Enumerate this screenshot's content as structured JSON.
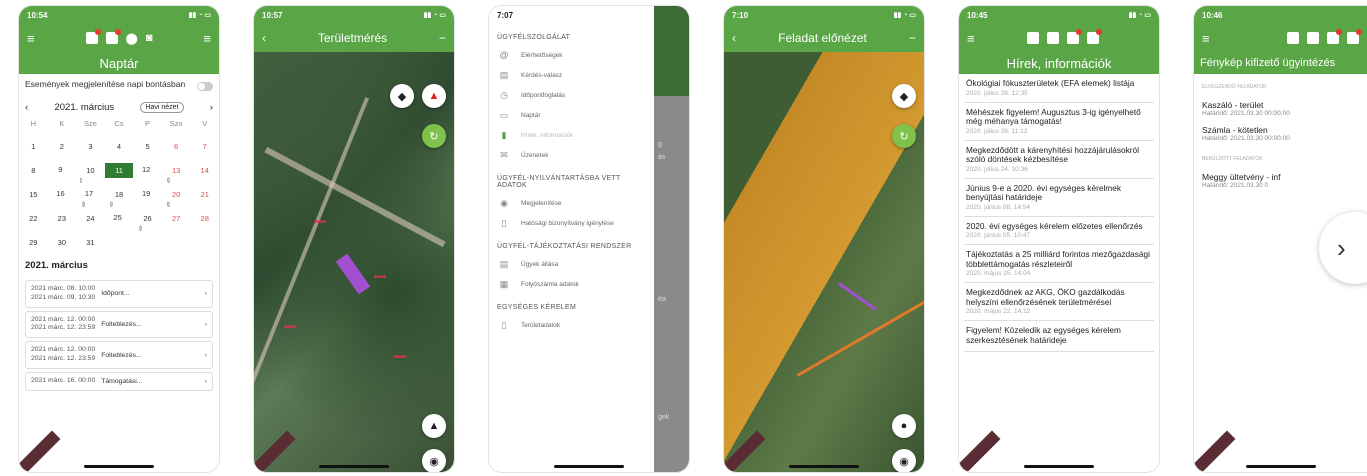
{
  "phone1": {
    "time": "10:54",
    "title": "Naptár",
    "toggle_label": "Események megjelenítése napi bontásban",
    "month": "2021. március",
    "today_button": "Havi nézet",
    "weekdays": [
      "H",
      "K",
      "Sze",
      "Cs",
      "P",
      "Szo",
      "V"
    ],
    "weeks": [
      [
        "1",
        "2",
        "3",
        "4",
        "5",
        "6",
        "7"
      ],
      [
        "8",
        "9",
        "10",
        "11",
        "12",
        "13",
        "14"
      ],
      [
        "15",
        "16",
        "17",
        "18",
        "19",
        "20",
        "21"
      ],
      [
        "22",
        "23",
        "24",
        "25",
        "26",
        "27",
        "28"
      ],
      [
        "29",
        "30",
        "31",
        "",
        "",
        "",
        ""
      ]
    ],
    "selected_day": "11",
    "section_title": "2021. március",
    "events": [
      {
        "time": "2021 márc. 08. 10:00\n2021 márc. 09. 10:30",
        "desc": "Időpont..."
      },
      {
        "time": "2021 márc. 12. 00:00\n2021 márc. 12. 23:59",
        "desc": "Folteblezés..."
      },
      {
        "time": "2021 márc. 12. 00:00\n2021 márc. 12. 23:59",
        "desc": "Folteblezés..."
      },
      {
        "time": "2021 márc. 16. 00:00",
        "desc": "Támogatási..."
      }
    ]
  },
  "phone2": {
    "time": "10:57",
    "title": "Területmérés"
  },
  "phone3": {
    "time": "7:07",
    "sections": [
      {
        "title": "ÜGYFÉLSZOLGÁLAT",
        "items": [
          {
            "icon": "@",
            "label": "Elérhetőségek"
          },
          {
            "icon": "▤",
            "label": "Kérdés-válasz"
          },
          {
            "icon": "◷",
            "label": "Időpontfoglalás"
          },
          {
            "icon": "▭",
            "label": "Naptár"
          },
          {
            "icon": "▮",
            "label": "Hírek, információk",
            "active": true
          },
          {
            "icon": "✉",
            "label": "Üzenetek"
          }
        ]
      },
      {
        "title": "ÜGYFÉL-NYILVÁNTARTÁSBA VETT ADATOK",
        "items": [
          {
            "icon": "◉",
            "label": "Megjelenítése"
          },
          {
            "icon": "▯",
            "label": "Hatósági bizonyítvány igénylése"
          }
        ]
      },
      {
        "title": "ÜGYFÉL-TÁJÉKOZTATÁSI RENDSZER",
        "items": [
          {
            "icon": "▤",
            "label": "Ügyek állása"
          },
          {
            "icon": "▦",
            "label": "Folyószámla adatok"
          }
        ]
      },
      {
        "title": "EGYSÉGES KÉRELEM",
        "items": [
          {
            "icon": "▯",
            "label": "Területadatok"
          }
        ]
      }
    ],
    "bg_texts": [
      "g",
      "ás",
      "éa",
      "gek"
    ]
  },
  "phone4": {
    "time": "7:10",
    "title": "Feladat előnézet"
  },
  "phone5": {
    "time": "10:45",
    "title": "Hírek, információk",
    "news": [
      {
        "title": "Ökológiai fókuszterületek (EFA elemek) listája",
        "date": "2020. július 28. 12:35"
      },
      {
        "title": "Méhészek figyelem! Augusztus 3-ig igényelhető még méhanya támogatás!",
        "date": "2020. július 28. 11:13"
      },
      {
        "title": "Megkezdődött a kárenyhítési hozzájárulásokról szóló döntések kézbesítése",
        "date": "2020. július 24. 10:36"
      },
      {
        "title": "Június 9-e a 2020. évi egységes kérelmek benyújtási határideje",
        "date": "2020. június 08. 14:54"
      },
      {
        "title": "2020. évi egységes kérelem előzetes ellenőrzés",
        "date": "2020. június 05. 10:47"
      },
      {
        "title": "Tájékoztatás a 25 milliárd forintos mezőgazdasági többlettámogatás részleteiről",
        "date": "2020. május 25. 14:04"
      },
      {
        "title": "Megkezdődnek az AKG, ÖKO gazdálkodás helyszíni ellenőrzésének területmérései",
        "date": "2020. május 22. 14:12"
      },
      {
        "title": "Figyelem! Közeledik az egységes kérelem szerkesztésének határideje",
        "date": ""
      }
    ]
  },
  "phone6": {
    "time": "10:46",
    "title": "Fénykép kifizető ügyintézés",
    "sec1": "ELVÉGZENDŐ FELADATOK",
    "items1": [
      {
        "title": "Kaszáló - terület",
        "date": "Határidő: 2021.03.30 00:00:00"
      },
      {
        "title": "Számla - kötetlen",
        "date": "Határidő: 2021.03.30 00:00:00"
      }
    ],
    "sec2": "BEKÜLDÖTT FELADATOK",
    "items2": [
      {
        "title": "Meggy ültetvény - inf",
        "date": "Határidő: 2021.03.30 0"
      }
    ],
    "arrow": "›"
  },
  "colors": {
    "green": "#5aa647",
    "dark_green": "#2e7d32",
    "red": "#e23a2e"
  }
}
